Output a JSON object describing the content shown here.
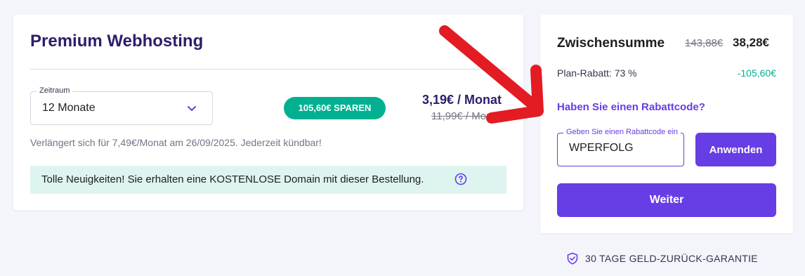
{
  "plan": {
    "title": "Premium Webhosting",
    "period_label": "Zeitraum",
    "period_value": "12 Monate",
    "savings_badge": "105,60€ SPAREN",
    "price_monthly": "3,19€ / Monat",
    "price_original": "11,99€ / Monat",
    "renewal_note": "Verlängert sich für 7,49€/Monat am 26/09/2025. Jederzeit kündbar!",
    "promo_banner": "Tolle Neuigkeiten! Sie erhalten eine KOSTENLOSE Domain mit dieser Bestellung."
  },
  "summary": {
    "subtotal_label": "Zwischensumme",
    "subtotal_original": "143,88€",
    "subtotal_total": "38,28€",
    "discount_label": "Plan-Rabatt: 73 %",
    "discount_value": "-105,60€",
    "coupon_link": "Haben Sie einen Rabattcode?",
    "coupon_field_label": "Geben Sie einen Rabattcode ein",
    "coupon_value": "WPERFOLG",
    "apply_label": "Anwenden",
    "continue_label": "Weiter"
  },
  "guarantee": {
    "text": "30 TAGE GELD-ZURÜCK-GARANTIE"
  },
  "colors": {
    "accent": "#673de6",
    "heading": "#2f1c6a",
    "success": "#00b090",
    "promo_bg": "#def4f0",
    "annotation_arrow": "#e31b23"
  },
  "icons": {
    "chevron": "chevron-down-icon",
    "help": "question-circle-icon",
    "shield": "shield-check-icon",
    "annotation": "red-arrow-annotation"
  }
}
